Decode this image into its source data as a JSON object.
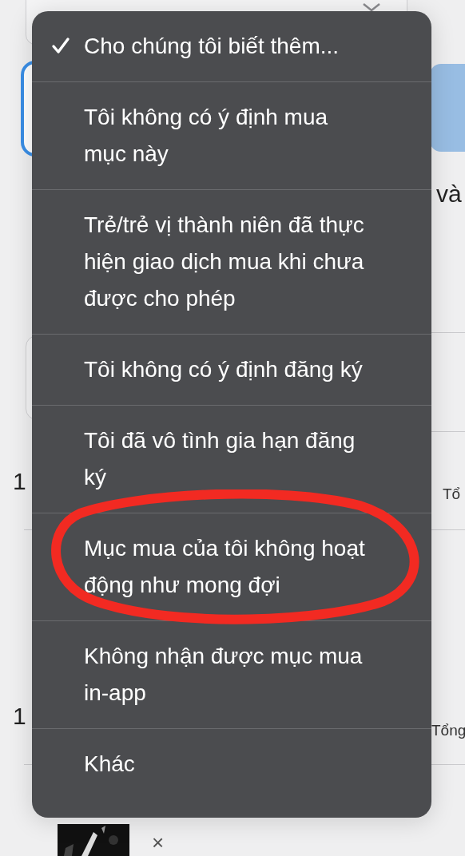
{
  "background": {
    "fragments": [
      {
        "text": "và",
        "kind": "title"
      },
      {
        "text": "1",
        "kind": "number"
      },
      {
        "text": "Tổ",
        "kind": "label"
      },
      {
        "text": "1",
        "kind": "number"
      },
      {
        "text": "Tổng",
        "kind": "label"
      },
      {
        "text": "×",
        "kind": "close"
      }
    ]
  },
  "menu": {
    "items": [
      {
        "label": "Cho chúng tôi biết thêm...",
        "selected": true
      },
      {
        "label": "Tôi không có ý định mua mục này",
        "selected": false
      },
      {
        "label": "Trẻ/trẻ vị thành niên đã thực hiện giao dịch mua khi chưa được cho phép",
        "selected": false
      },
      {
        "label": "Tôi không có ý định đăng ký",
        "selected": false
      },
      {
        "label": "Tôi đã vô tình gia hạn đăng ký",
        "selected": false
      },
      {
        "label": "Mục mua của tôi không hoạt động như mong đợi",
        "selected": false,
        "circled": true
      },
      {
        "label": "Không nhận được mục mua in-app",
        "selected": false
      },
      {
        "label": "Khác",
        "selected": false
      }
    ]
  }
}
